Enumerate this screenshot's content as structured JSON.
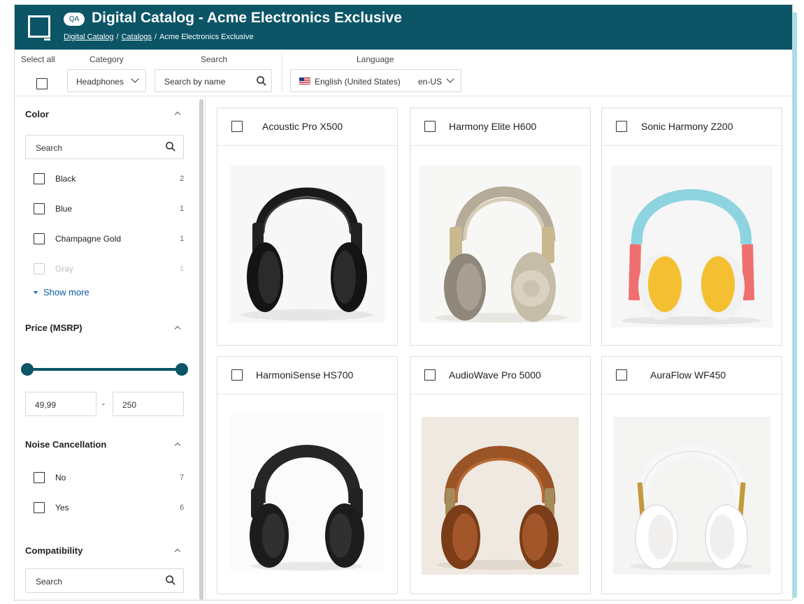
{
  "header": {
    "badge": "QA",
    "title": "Digital Catalog - Acme Electronics Exclusive",
    "breadcrumb": [
      "Digital Catalog",
      "Catalogs",
      "Acme Electronics Exclusive"
    ],
    "bg_color": "#0b5567"
  },
  "toolbar": {
    "select_all_label": "Select all",
    "category_label": "Category",
    "category_value": "Headphones",
    "search_label": "Search",
    "search_placeholder": "Search by name",
    "language_label": "Language",
    "language_value": "English (United States)",
    "language_code": "en-US"
  },
  "sidebar": {
    "color": {
      "title": "Color",
      "search_placeholder": "Search",
      "items": [
        {
          "label": "Black",
          "count": "2"
        },
        {
          "label": "Blue",
          "count": "1"
        },
        {
          "label": "Champagne Gold",
          "count": "1"
        },
        {
          "label": "Gray",
          "count": "1"
        }
      ],
      "show_more": "Show more"
    },
    "price": {
      "title": "Price (MSRP)",
      "min": "49,99",
      "max": "250",
      "separator": "-"
    },
    "noise": {
      "title": "Noise Cancellation",
      "items": [
        {
          "label": "No",
          "count": "7"
        },
        {
          "label": "Yes",
          "count": "6"
        }
      ]
    },
    "compat": {
      "title": "Compatibility",
      "search_placeholder": "Search"
    }
  },
  "products": [
    {
      "name": "Acoustic Pro X500",
      "image": "black-headphones"
    },
    {
      "name": "Harmony Elite H600",
      "image": "champagne-gold-headphones"
    },
    {
      "name": "Sonic Harmony Z200",
      "image": "blue-red-yellow-headphones"
    },
    {
      "name": "HarmoniSense HS700",
      "image": "matte-black-headphones"
    },
    {
      "name": "AudioWave Pro 5000",
      "image": "brown-leather-headphones"
    },
    {
      "name": "AuraFlow WF450",
      "image": "white-gold-headphones"
    }
  ]
}
